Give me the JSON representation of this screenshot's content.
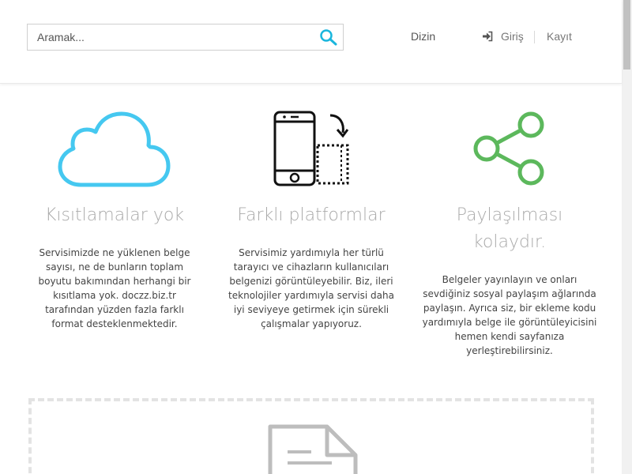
{
  "search": {
    "placeholder": "Aramak..."
  },
  "nav": {
    "dizin": "Dizin",
    "giris": "Giriş",
    "kayit": "Kayıt"
  },
  "features": [
    {
      "title": "Kısıtlamalar yok",
      "text": "Servisimizde ne yüklenen belge sayısı, ne de bunların toplam boyutu bakımından herhangi bir kısıtlama yok. doczz.biz.tr tarafından yüzden fazla farklı format desteklenmektedir.",
      "icon": "cloud-icon",
      "color": "#45c8f0"
    },
    {
      "title": "Farklı platformlar",
      "text": "Servisimiz yardımıyla her türlü tarayıcı ve cihazların kullanıcıları belgenizi görüntüleyebilir. Biz, ileri teknolojiler yardımıyla servisi daha iyi seviyeye getirmek için sürekli çalışmalar yapıyoruz.",
      "icon": "devices-icon",
      "color": "#111111"
    },
    {
      "title": "Paylaşılması kolaydır.",
      "text": "Belgeler yayınlayın ve onları sevdiğiniz sosyal paylaşım ağlarında paylaşın. Ayrıca siz, bir ekleme kodu yardımıyla belge ile görüntüleyicisini hemen kendi sayfanıza yerleştirebilirsiniz.",
      "icon": "share-icon",
      "color": "#5cb85c"
    }
  ],
  "upload": {
    "icon": "document-icon"
  }
}
